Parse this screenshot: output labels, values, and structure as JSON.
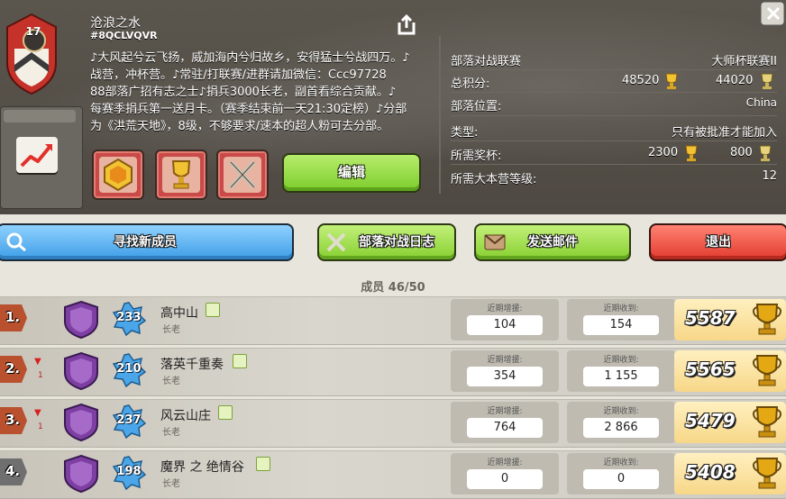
{
  "clan": {
    "level": "17",
    "name": "沧浪之水",
    "tag": "#8QCLVQVR",
    "description_lines": [
      "♪大风起兮云飞扬，威加海内兮归故乡，安得猛士兮战四万。♪",
      "战营，冲杯营。♪常驻/打联赛/进群请加微信：Ccc97728",
      "88部落广招有志之士♪捐兵3000长老，副首看综合贡献。♪",
      "每赛季捐兵第一送月卡。（赛季结束前一天21:30定榜）♪分部",
      "为《洪荒天地》，8级，不够要求/速本的超人粉可去分部。"
    ],
    "edit_label": "编辑"
  },
  "info": {
    "war_league_label": "部落对战联赛",
    "war_league_value": "大师杯联赛II",
    "total_points_label": "总积分:",
    "total_points_home": "48520",
    "total_points_builder": "44020",
    "location_label": "部落位置:",
    "location_value": "China",
    "type_label": "类型:",
    "type_value": "只有被批准才能加入",
    "required_trophies_label": "所需奖杯:",
    "required_trophies_home": "2300",
    "required_trophies_builder": "800",
    "required_th_label": "所需大本营等级:",
    "required_th_value": "12"
  },
  "actions": {
    "find_members": "寻找新成员",
    "war_log": "部落对战日志",
    "send_mail": "发送邮件",
    "leave": "退出"
  },
  "members_header": "成员 46/50",
  "stat_labels": {
    "donated": "近期增援:",
    "received": "近期收到:"
  },
  "members": [
    {
      "rank": "1.",
      "trend": "",
      "trend_num": "",
      "level": "233",
      "name": "高中山",
      "role": "长老",
      "donated": "104",
      "received": "154",
      "trophies": "5587"
    },
    {
      "rank": "2.",
      "trend": "▼",
      "trend_num": "1",
      "level": "210",
      "name": "落英千重奏",
      "role": "长老",
      "donated": "354",
      "received": "1 155",
      "trophies": "5565"
    },
    {
      "rank": "3.",
      "trend": "▼",
      "trend_num": "1",
      "level": "237",
      "name": "风云山庄",
      "role": "长老",
      "donated": "764",
      "received": "2 866",
      "trophies": "5479"
    },
    {
      "rank": "4.",
      "trend": "",
      "trend_num": "",
      "level": "198",
      "name": "魔界 之 绝情谷",
      "role": "长老",
      "donated": "0",
      "received": "0",
      "trophies": "5408"
    }
  ],
  "colors": {
    "edit_green": "#86cf30",
    "find_blue": "#3e9ee6",
    "leave_red": "#e23b2e",
    "trophy_gold": "#e3a814"
  }
}
